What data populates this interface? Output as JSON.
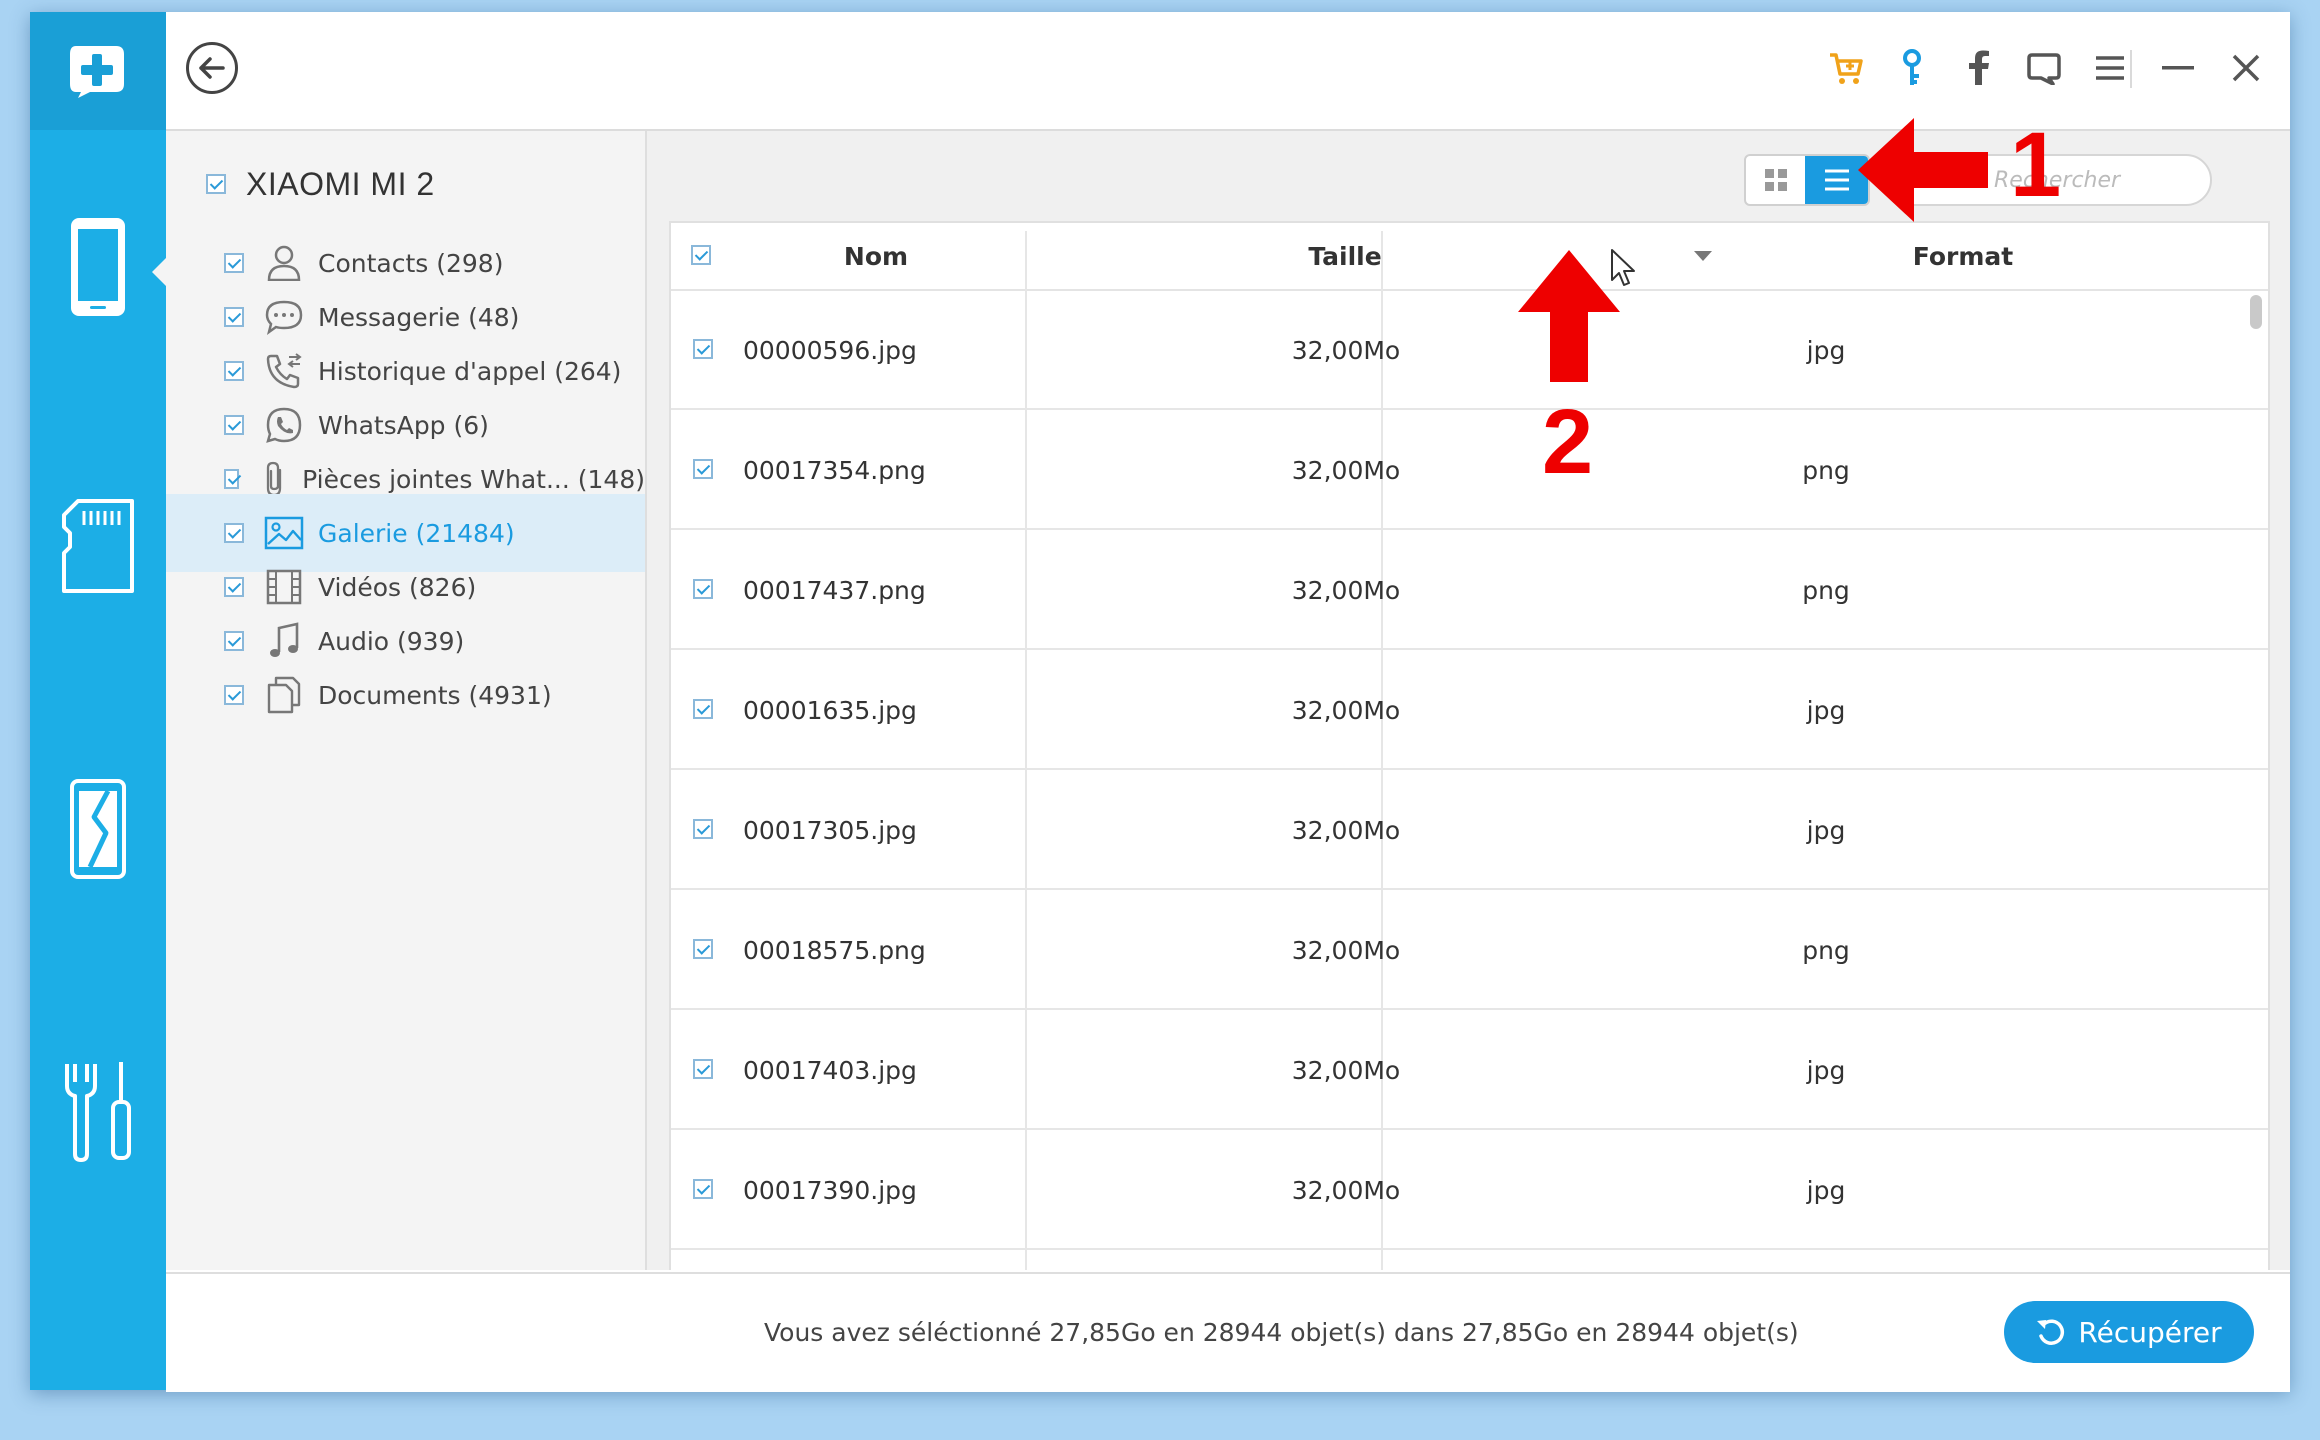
{
  "app": {
    "logo_icon": "plus-logo-icon",
    "accent_color": "#1caee6",
    "button_color": "#1a9be0"
  },
  "rail": [
    {
      "name": "phone-icon",
      "active": true
    },
    {
      "name": "sd-card-icon",
      "active": false
    },
    {
      "name": "broken-phone-icon",
      "active": false
    },
    {
      "name": "tools-icon",
      "active": false
    }
  ],
  "titlebar": {
    "back_icon": "back-arrow-icon",
    "icons": [
      "cart-icon",
      "key-icon",
      "facebook-icon",
      "feedback-icon",
      "menu-icon",
      "minimize-icon",
      "close-icon"
    ]
  },
  "device": {
    "name": "XIAOMI MI 2",
    "checked": true
  },
  "categories": [
    {
      "label": "Contacts (298)",
      "icon": "contact-icon",
      "checked": true,
      "selected": false
    },
    {
      "label": "Messagerie (48)",
      "icon": "message-icon",
      "checked": true,
      "selected": false
    },
    {
      "label": "Historique d'appel (264)",
      "icon": "call-history-icon",
      "checked": true,
      "selected": false
    },
    {
      "label": "WhatsApp (6)",
      "icon": "whatsapp-icon",
      "checked": true,
      "selected": false
    },
    {
      "label": "Pièces jointes What... (148)",
      "icon": "attachment-icon",
      "checked": true,
      "selected": false
    },
    {
      "label": "Galerie (21484)",
      "icon": "gallery-icon",
      "checked": true,
      "selected": true
    },
    {
      "label": "Vidéos (826)",
      "icon": "video-icon",
      "checked": true,
      "selected": false
    },
    {
      "label": "Audio (939)",
      "icon": "audio-icon",
      "checked": true,
      "selected": false
    },
    {
      "label": "Documents (4931)",
      "icon": "documents-icon",
      "checked": true,
      "selected": false
    }
  ],
  "toolbar": {
    "view_mode": "list",
    "search_placeholder": "Rechercher"
  },
  "table": {
    "columns": [
      "Nom",
      "Taille",
      "Format"
    ],
    "sort_column": "Taille",
    "rows": [
      {
        "name": "00000596.jpg",
        "size": "32,00Mo",
        "format": "jpg",
        "checked": true
      },
      {
        "name": "00017354.png",
        "size": "32,00Mo",
        "format": "png",
        "checked": true
      },
      {
        "name": "00017437.png",
        "size": "32,00Mo",
        "format": "png",
        "checked": true
      },
      {
        "name": "00001635.jpg",
        "size": "32,00Mo",
        "format": "jpg",
        "checked": true
      },
      {
        "name": "00017305.jpg",
        "size": "32,00Mo",
        "format": "jpg",
        "checked": true
      },
      {
        "name": "00018575.png",
        "size": "32,00Mo",
        "format": "png",
        "checked": true
      },
      {
        "name": "00017403.jpg",
        "size": "32,00Mo",
        "format": "jpg",
        "checked": true
      },
      {
        "name": "00017390.jpg",
        "size": "32,00Mo",
        "format": "jpg",
        "checked": true
      }
    ]
  },
  "footer": {
    "status": "Vous avez séléctionné 27,85Go en 28944 objet(s) dans 27,85Go en 28944 objet(s)",
    "recover_label": "Récupérer",
    "recover_icon": "undo-icon"
  },
  "annotations": {
    "arrow1_label": "1",
    "arrow2_label": "2",
    "color": "#ee0000"
  }
}
